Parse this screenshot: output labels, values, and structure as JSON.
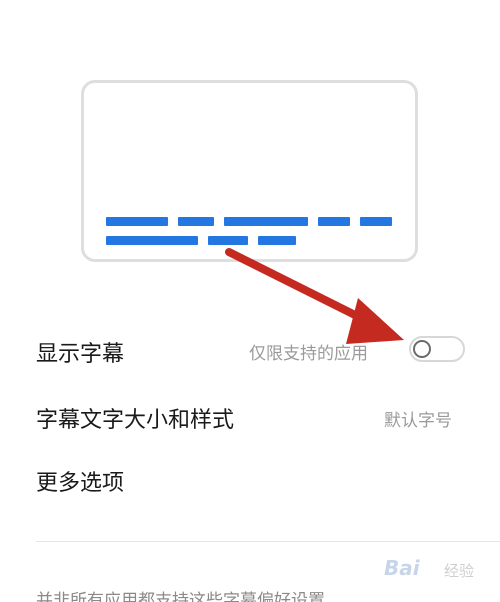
{
  "settings": {
    "show_captions": {
      "label": "显示字幕",
      "note": "仅限支持的应用",
      "toggle_on": false
    },
    "caption_size_style": {
      "label": "字幕文字大小和样式",
      "value": "默认字号"
    },
    "more_options": {
      "label": "更多选项"
    }
  },
  "footer": {
    "text": "并非所有应用都支持这些字幕偏好设置"
  },
  "preview": {
    "accent_color": "#2477e0"
  },
  "annotation": {
    "arrow_color": "#c42a1f"
  },
  "watermark": {
    "brand": "Bai",
    "sub": "经验"
  }
}
